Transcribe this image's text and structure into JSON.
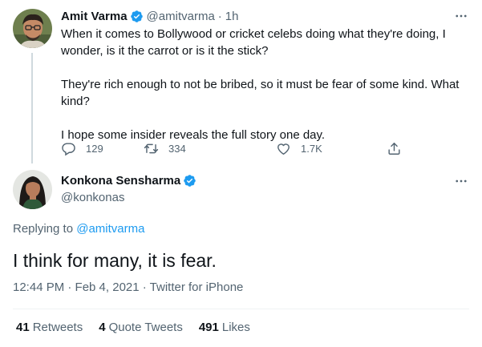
{
  "parent_tweet": {
    "name": "Amit Varma",
    "handle": "@amitvarma",
    "separator": "·",
    "time": "1h",
    "paragraphs": [
      "When it comes to Bollywood or cricket celebs doing what they're doing, I wonder, is it the carrot or is it the stick?",
      "They're rich enough to not be bribed, so it must be fear of some kind. What kind?",
      "I hope some insider reveals the full story one day."
    ],
    "actions": {
      "reply_count": "129",
      "retweet_count": "334",
      "like_count": "1.7K"
    }
  },
  "main_tweet": {
    "name": "Konkona Sensharma",
    "handle": "@konkonas",
    "replying_prefix": "Replying to",
    "replying_handle": "@amitvarma",
    "text": "I think for many, it is fear.",
    "meta": "12:44 PM · Feb 4, 2021 · Twitter for iPhone"
  },
  "stats": [
    {
      "count": "41",
      "label": "Retweets"
    },
    {
      "count": "4",
      "label": "Quote Tweets"
    },
    {
      "count": "491",
      "label": "Likes"
    }
  ],
  "more_label": "···",
  "colors": {
    "accent": "#1d9bf0",
    "secondary_text": "#536471",
    "primary_text": "#0f1419",
    "divider": "#eff3f4",
    "thread_line": "#cfd9de"
  },
  "icons": {
    "verified": "verified-badge-icon",
    "reply": "reply-icon",
    "retweet": "retweet-icon",
    "like": "heart-icon",
    "share": "share-icon",
    "more": "more-icon"
  }
}
